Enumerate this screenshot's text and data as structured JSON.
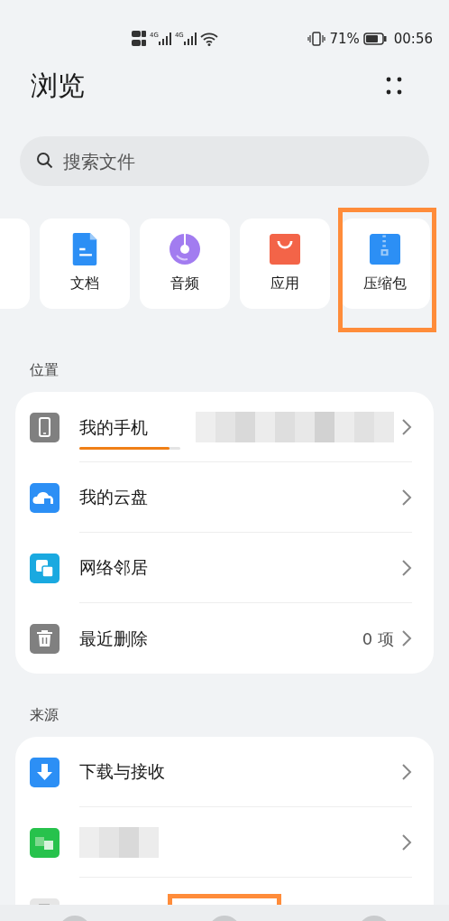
{
  "status_bar": {
    "network_labels": [
      "4G",
      "4G"
    ],
    "battery": "71%",
    "time": "00:56"
  },
  "title": "浏览",
  "search": {
    "placeholder": "搜索文件"
  },
  "categories": [
    {
      "kind": "partial"
    },
    {
      "kind": "document",
      "label": "文档",
      "highlighted": false
    },
    {
      "kind": "audio",
      "label": "音频",
      "highlighted": false
    },
    {
      "kind": "app",
      "label": "应用",
      "highlighted": false
    },
    {
      "kind": "archive",
      "label": "压缩包",
      "highlighted": true
    }
  ],
  "sections": [
    {
      "heading": "位置",
      "items": [
        {
          "kind": "phone",
          "label": "我的手机",
          "level": 0.89,
          "redacted": true
        },
        {
          "kind": "cloud",
          "label": "我的云盘"
        },
        {
          "kind": "network",
          "label": "网络邻居"
        },
        {
          "kind": "trash",
          "label": "最近删除",
          "value": "0 项"
        }
      ]
    },
    {
      "heading": "来源",
      "items": [
        {
          "kind": "download",
          "label": "下载与接收"
        },
        {
          "kind": "redacted"
        },
        {
          "kind": "redacted-cut"
        }
      ]
    }
  ],
  "bottom_nav": [
    {
      "highlighted": false
    },
    {
      "highlighted": true
    },
    {
      "highlighted": false
    }
  ]
}
